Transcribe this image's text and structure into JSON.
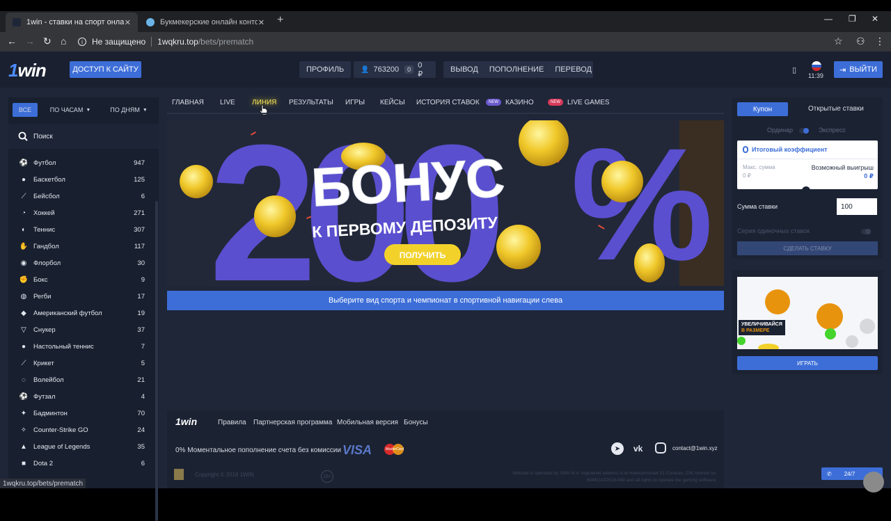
{
  "browser": {
    "tabs": [
      {
        "title": "1win - ставки на спорт онлайн",
        "active": true
      },
      {
        "title": "Букмекерские онлайн конторы",
        "active": false
      }
    ],
    "security_label": "Не защищено",
    "url_domain": "1wqkru.top",
    "url_path": "/bets/prematch",
    "status_url": "1wqkru.top/bets/prematch"
  },
  "header": {
    "logo_one": "1",
    "logo_win": "win",
    "access_button": "ДОСТУП К САЙТУ",
    "profile": "ПРОФИЛЬ",
    "user_id": "763200",
    "balance_count": "0",
    "balance": "0 ₽",
    "withdraw": "ВЫВОД",
    "deposit": "ПОПОЛНЕНИЕ",
    "transfer": "ПЕРЕВОД",
    "time": "11:39",
    "logout": "ВЫЙТИ"
  },
  "sidebar": {
    "filters": [
      "ВСЕ",
      "ПО ЧАСАМ",
      "ПО ДНЯМ"
    ],
    "search_label": "Поиск",
    "sports": [
      {
        "name": "Футбол",
        "count": "947",
        "icon": "⚽"
      },
      {
        "name": "Баскетбол",
        "count": "125",
        "icon": "●"
      },
      {
        "name": "Бейсбол",
        "count": "6",
        "icon": "⟋"
      },
      {
        "name": "Хоккей",
        "count": "271",
        "icon": "◔"
      },
      {
        "name": "Теннис",
        "count": "307",
        "icon": "◐"
      },
      {
        "name": "Гандбол",
        "count": "117",
        "icon": "✋"
      },
      {
        "name": "Флорбол",
        "count": "30",
        "icon": "◉"
      },
      {
        "name": "Бокс",
        "count": "9",
        "icon": "✊"
      },
      {
        "name": "Регби",
        "count": "17",
        "icon": "◍"
      },
      {
        "name": "Американский футбол",
        "count": "19",
        "icon": "◆"
      },
      {
        "name": "Снукер",
        "count": "37",
        "icon": "▽"
      },
      {
        "name": "Настольный теннис",
        "count": "7",
        "icon": "●"
      },
      {
        "name": "Крикет",
        "count": "5",
        "icon": "⟋"
      },
      {
        "name": "Волейбол",
        "count": "21",
        "icon": "◌"
      },
      {
        "name": "Футзал",
        "count": "4",
        "icon": "⚽"
      },
      {
        "name": "Бадминтон",
        "count": "70",
        "icon": "✦"
      },
      {
        "name": "Counter-Strike GO",
        "count": "24",
        "icon": "✧"
      },
      {
        "name": "League of Legends",
        "count": "35",
        "icon": "▲"
      },
      {
        "name": "Dota 2",
        "count": "6",
        "icon": "■"
      }
    ]
  },
  "main_nav": {
    "items": [
      "ГЛАВНАЯ",
      "LIVE",
      "ЛИНИЯ",
      "РЕЗУЛЬТАТЫ",
      "ИГРЫ",
      "КЕЙСЫ",
      "ИСТОРИЯ СТАВОК"
    ],
    "new_badge": "NEW",
    "casino": "КАЗИНО",
    "live_games": "LIVE GAMES"
  },
  "banner": {
    "headline": "БОНУС",
    "subline": "К ПЕРВОМУ ДЕПОЗИТУ",
    "big_number": "200",
    "percent": "%",
    "button": "ПОЛУЧИТЬ"
  },
  "info_bar": "Выберите вид спорта и чемпионат в спортивной навигации слева",
  "footer": {
    "logo": "1win",
    "links": [
      "Правила",
      "Партнерская программа",
      "Мобильная версия",
      "Бонусы"
    ],
    "commission_text": "0% Моментальное пополнение счета без комиссии",
    "visa": "VISA",
    "mastercard": "MasterCard",
    "email": "contact@1win.xyz",
    "copyright": "Copyright © 2018 1WIN",
    "age": "18+",
    "legal": "Website is operated by 1Win N.V. registered address is at Heelsumstraat 51 Curacao, CW, license no. 8048/JAZ2016-040 and all rights to operate the gaming software."
  },
  "coupon": {
    "tab_coupon": "Купон",
    "tab_open": "Открытые ставки",
    "single": "Ординар",
    "express": "Экспресс",
    "total_coef": "Итоговый коэффициент",
    "max_sum": "Макс. сумма",
    "max_sum_val": "0 ₽",
    "possible_win": "Возможный выигрыш",
    "possible_win_val": "0 ₽",
    "stake_label": "Сумма ставки",
    "stake_value": "100",
    "series_label": "Серия одиночных ставок",
    "place_bet": "СДЕЛАТЬ СТАВКУ"
  },
  "game_promo": {
    "caption_line1": "УВЕЛИЧИВАЙСЯ",
    "caption_line2": "В РАЗМЕРЕ",
    "play": "ИГРАТЬ"
  },
  "support": {
    "label": "24/7"
  }
}
